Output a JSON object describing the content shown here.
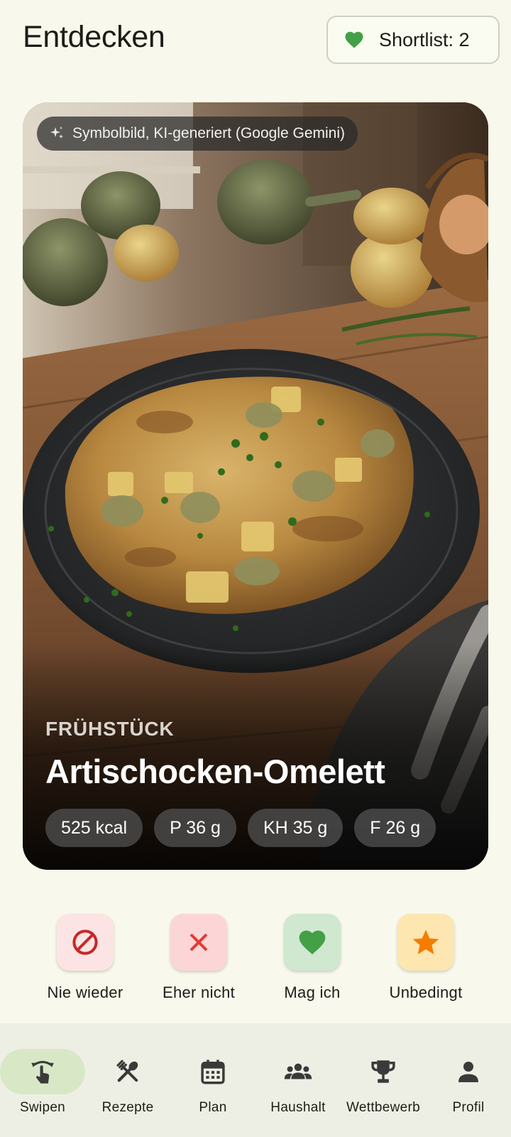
{
  "header": {
    "title": "Entdecken",
    "shortlist_label": "Shortlist: 2"
  },
  "card": {
    "ai_badge": "Symbolbild, KI-generiert (Google Gemini)",
    "meal_type": "FRÜHSTÜCK",
    "recipe_name": "Artischocken-Omelett",
    "macros": [
      "525 kcal",
      "P 36 g",
      "KH 35 g",
      "F 26 g"
    ]
  },
  "actions": [
    {
      "label": "Nie wieder",
      "icon": "block-icon",
      "color": "#c62828",
      "bg": "#fde4e4"
    },
    {
      "label": "Eher nicht",
      "icon": "close-icon",
      "color": "#e53935",
      "bg": "#fcd6d6"
    },
    {
      "label": "Mag ich",
      "icon": "heart-icon",
      "color": "#43a047",
      "bg": "#cfe8cf"
    },
    {
      "label": "Unbedingt",
      "icon": "star-icon",
      "color": "#f57c00",
      "bg": "#fde6b0"
    }
  ],
  "nav": {
    "items": [
      {
        "label": "Swipen",
        "icon": "swipe-icon",
        "active": true
      },
      {
        "label": "Rezepte",
        "icon": "utensils-icon",
        "active": false
      },
      {
        "label": "Plan",
        "icon": "calendar-icon",
        "active": false
      },
      {
        "label": "Haushalt",
        "icon": "group-icon",
        "active": false
      },
      {
        "label": "Wettbewerb",
        "icon": "trophy-icon",
        "active": false
      },
      {
        "label": "Profil",
        "icon": "person-icon",
        "active": false
      }
    ]
  },
  "colors": {
    "background": "#f8f9ec",
    "accent_green": "#43a047",
    "nav_active_bg": "#d8e8c6",
    "nav_bg": "#eeefe4"
  }
}
